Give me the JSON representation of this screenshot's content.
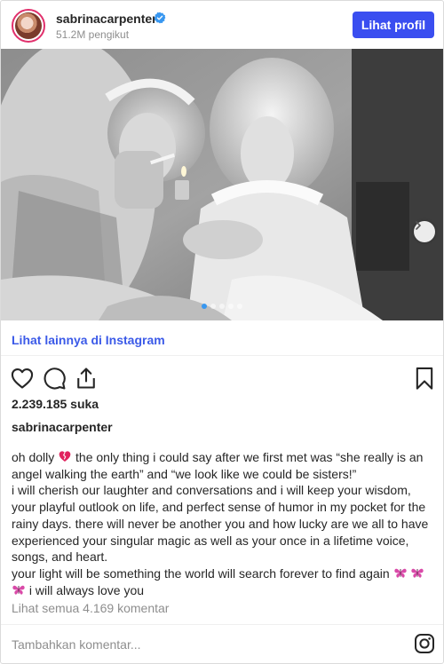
{
  "header": {
    "username": "sabrinacarpenter",
    "followers": "51.2M pengikut",
    "profile_button": "Lihat profil"
  },
  "post": {
    "view_more_link": "Lihat lainnya di Instagram",
    "carousel_total": 5,
    "carousel_active": 1,
    "likes": "2.239.185 suka",
    "caption_user": "sabrinacarpenter",
    "caption_lines": [
      "oh dolly",
      "the only thing i could say after we first met was “she really is an",
      "angel walking the earth” and “we look like we could be sisters!”",
      "i will cherish our laughter and conversations and i will keep your wisdom,",
      "your playful outlook on life, and perfect sense of humor in my pocket for the",
      "rainy days. there will never be another you and how lucky are we all to have",
      "experienced your singular magic as well as your once in a lifetime voice,",
      "songs, and heart.",
      "your light will be something the world will search forever to find again",
      "i will always love you"
    ],
    "view_all_comments": "Lihat semua 4.169 komentar",
    "add_comment_placeholder": "Tambahkan komentar..."
  },
  "colors": {
    "accent_button": "#3a4ef0",
    "link": "#3b5ae8",
    "muted_text": "#8e8e8e",
    "verified": "#3897f0"
  },
  "icons": [
    "verified-badge-icon",
    "chevron-right-icon",
    "heart-icon",
    "comment-icon",
    "share-icon",
    "bookmark-icon",
    "broken-heart-emoji",
    "butterfly-emoji",
    "instagram-icon"
  ]
}
